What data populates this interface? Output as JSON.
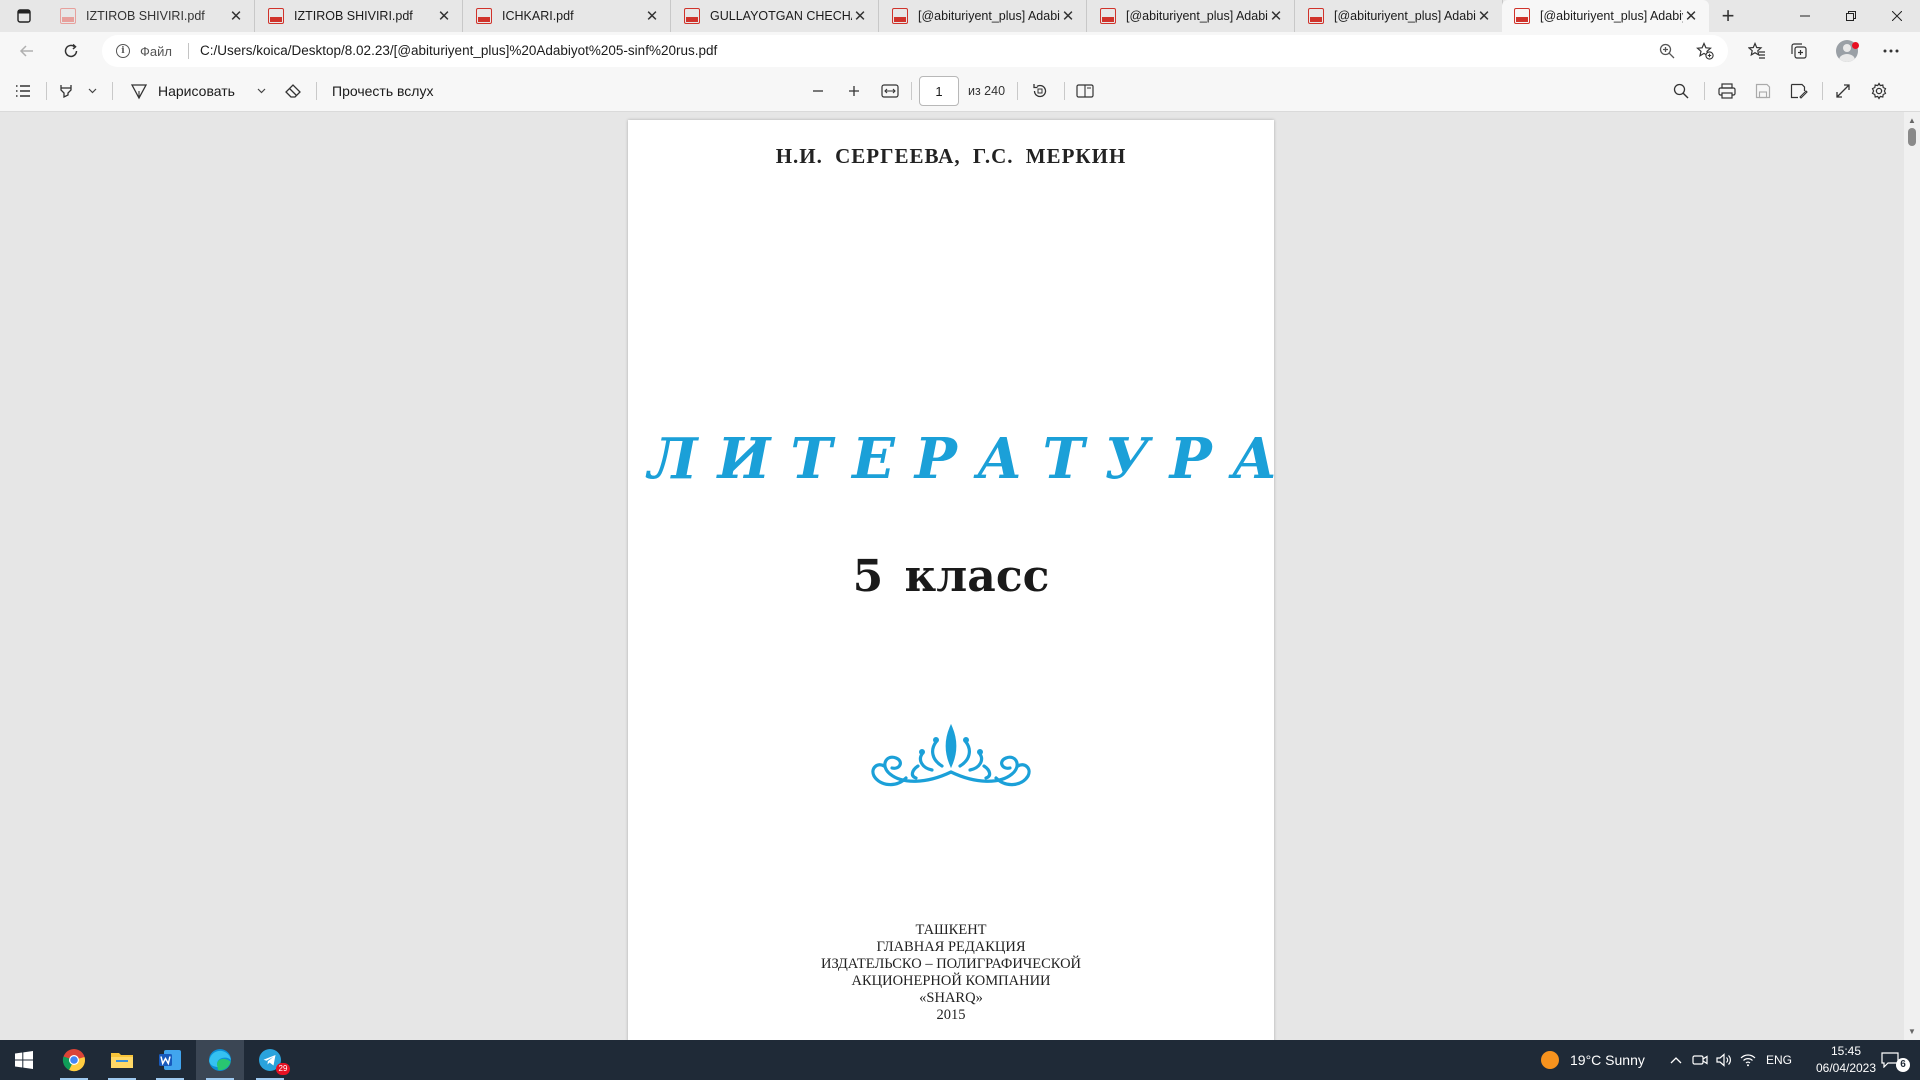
{
  "tabs": [
    {
      "title": "IZTIROB SHIVIRI.pdf",
      "active": false
    },
    {
      "title": "IZTIROB SHIVIRI.pdf",
      "active": false
    },
    {
      "title": "ICHKARI.pdf",
      "active": false
    },
    {
      "title": "GULLAYOTGAN CHECHAKLAR",
      "active": false
    },
    {
      "title": "[@abituriyent_plus] Adabiyot",
      "active": false
    },
    {
      "title": "[@abituriyent_plus] Adabiyot",
      "active": false
    },
    {
      "title": "[@abituriyent_plus] Adabiyot",
      "active": false
    },
    {
      "title": "[@abituriyent_plus] Adabiyot",
      "active": true
    }
  ],
  "address": {
    "file_label": "Файл",
    "url": "C:/Users/koica/Desktop/8.02.23/[@abituriyent_plus]%20Adabiyot%205-sinf%20rus.pdf"
  },
  "pdf_toolbar": {
    "draw_label": "Нарисовать",
    "read_aloud_label": "Прочесть вслух",
    "page_current": "1",
    "page_total": "из 240"
  },
  "document": {
    "authors": "Н.И. СЕРГЕЕВА,  Г.С. МЕРКИН",
    "title": "ЛИТЕРАТУРА",
    "grade": "5 класс",
    "imprint": {
      "line1": "ТАШКЕНТ",
      "line2": "ГЛАВНАЯ РЕДАКЦИЯ",
      "line3": "ИЗДАТЕЛЬСКО – ПОЛИГРАФИЧЕСКОЙ",
      "line4": "АКЦИОНЕРНОЙ КОМПАНИИ",
      "line5": "«SHARQ»",
      "line6": "2015"
    }
  },
  "taskbar": {
    "apps": [
      "windows-start",
      "chrome",
      "file-explorer",
      "word",
      "edge",
      "telegram"
    ],
    "telegram_badge": "29",
    "weather": "19°C  Sunny",
    "language": "ENG",
    "time": "15:45",
    "date": "06/04/2023",
    "notifications": "6"
  },
  "colors": {
    "title_blue": "#1ba0d8",
    "pdf_red": "#d0332b",
    "taskbar": "#1f2a37"
  }
}
